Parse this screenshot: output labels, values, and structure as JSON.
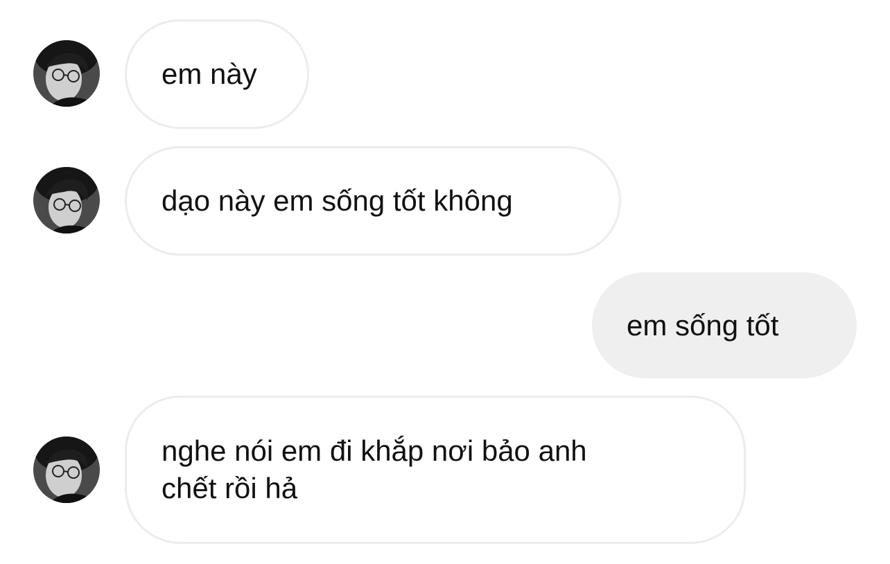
{
  "conversation": {
    "accent_incoming_border": "#ececec",
    "accent_outgoing_bg": "#efefef",
    "avatar_icon": "user-avatar-photo",
    "messages": [
      {
        "side": "incoming",
        "text": "em này"
      },
      {
        "side": "incoming",
        "text": "dạo này em sống tốt không"
      },
      {
        "side": "outgoing",
        "text": "em sống tốt"
      },
      {
        "side": "incoming",
        "text": "nghe nói em đi khắp nơi bảo anh\nchết rồi hả"
      }
    ]
  }
}
